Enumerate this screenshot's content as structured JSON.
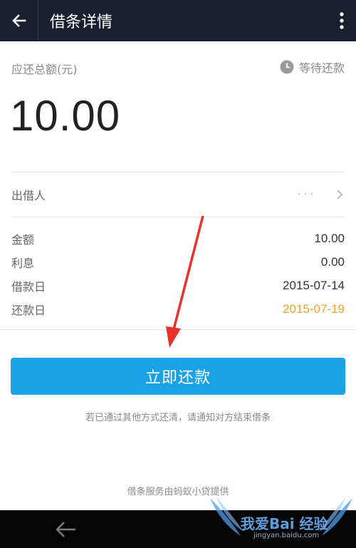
{
  "appbar": {
    "title": "借条详情",
    "back_icon": "arrow-left-icon",
    "more_icon": "more-vertical-icon"
  },
  "summary": {
    "label": "应还总额(元)",
    "status": "等待还款",
    "status_icon": "clock-icon",
    "amount": "10.00"
  },
  "lender": {
    "label": "出借人",
    "value": "· · ·",
    "chevron_icon": "chevron-right-icon"
  },
  "details": [
    {
      "key": "金额",
      "value": "10.00"
    },
    {
      "key": "利息",
      "value": "0.00"
    },
    {
      "key": "借款日",
      "value": "2015-07-14"
    },
    {
      "key": "还款日",
      "value": "2015-07-19"
    }
  ],
  "repay_button": "立即还款",
  "note": "若已通过其他方式还清，请通知对方结束借条",
  "footer_note": "借条服务由蚂蚁小贷提供",
  "watermark": {
    "line1": "我爱Bai 经验",
    "line2": "jingyan.baidu.com"
  },
  "colors": {
    "appbar": "#1b2030",
    "accent": "#1aa1e6",
    "due_date": "#f0a132",
    "annotation_arrow": "#e8322a"
  }
}
